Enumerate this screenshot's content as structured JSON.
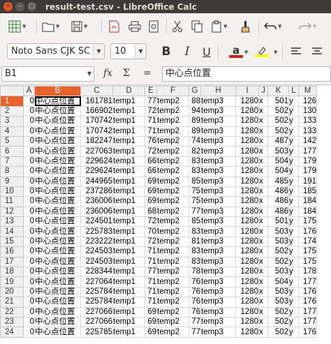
{
  "window": {
    "title": "result-test.csv - LibreOffice Calc",
    "close_glyph": "×",
    "min_glyph": "–",
    "max_glyph": "□"
  },
  "toolbar": {
    "icons": [
      "spreadsheet-icon",
      "open-icon",
      "save-icon",
      "export-pdf-icon",
      "print-icon",
      "print-preview-icon",
      "cut-icon",
      "copy-icon",
      "paste-icon",
      "clone-formatting-icon",
      "undo-icon",
      "redo-icon"
    ]
  },
  "format": {
    "font_name": "Noto Sans CJK SC R",
    "font_size": "10",
    "bold": "B",
    "italic": "I",
    "underline": "U",
    "font_color_glyph": "a",
    "font_color": "#c9211e",
    "highlight_color": "#ffff00"
  },
  "formula_bar": {
    "cell_ref": "B1",
    "fx": "fx",
    "sigma": "Σ",
    "equals": "=",
    "content": "中心点位置"
  },
  "sheet": {
    "columns": [
      "A",
      "B",
      "C",
      "D",
      "E",
      "F",
      "G",
      "H",
      "I",
      "J",
      "K",
      "L",
      "M"
    ],
    "selected_column": "B",
    "selected_row": "1",
    "rows": [
      {
        "n": "1",
        "a": "0",
        "b": "中心点位置",
        "c": "161781",
        "d": "temp1",
        "e": "77",
        "f": "temp2",
        "g": "88",
        "h": "temp3",
        "i": "1280",
        "j": "x",
        "k": "501",
        "l": "y",
        "m": "126"
      },
      {
        "n": "2",
        "a": "0",
        "b": "中心点位置",
        "c": "166902",
        "d": "temp1",
        "e": "72",
        "f": "temp2",
        "g": "94",
        "h": "temp3",
        "i": "1280",
        "j": "x",
        "k": "502",
        "l": "y",
        "m": "130"
      },
      {
        "n": "3",
        "a": "0",
        "b": "中心点位置",
        "c": "170742",
        "d": "temp1",
        "e": "71",
        "f": "temp2",
        "g": "89",
        "h": "temp3",
        "i": "1280",
        "j": "x",
        "k": "502",
        "l": "y",
        "m": "133"
      },
      {
        "n": "4",
        "a": "0",
        "b": "中心点位置",
        "c": "170742",
        "d": "temp1",
        "e": "71",
        "f": "temp2",
        "g": "89",
        "h": "temp3",
        "i": "1280",
        "j": "x",
        "k": "502",
        "l": "y",
        "m": "133"
      },
      {
        "n": "5",
        "a": "0",
        "b": "中心点位置",
        "c": "182247",
        "d": "temp1",
        "e": "76",
        "f": "temp2",
        "g": "74",
        "h": "temp3",
        "i": "1280",
        "j": "x",
        "k": "487",
        "l": "y",
        "m": "142"
      },
      {
        "n": "6",
        "a": "0",
        "b": "中心点位置",
        "c": "227063",
        "d": "temp1",
        "e": "72",
        "f": "temp2",
        "g": "82",
        "h": "temp3",
        "i": "1280",
        "j": "x",
        "k": "503",
        "l": "y",
        "m": "177"
      },
      {
        "n": "7",
        "a": "0",
        "b": "中心点位置",
        "c": "229624",
        "d": "temp1",
        "e": "66",
        "f": "temp2",
        "g": "83",
        "h": "temp3",
        "i": "1280",
        "j": "x",
        "k": "504",
        "l": "y",
        "m": "179"
      },
      {
        "n": "8",
        "a": "0",
        "b": "中心点位置",
        "c": "229624",
        "d": "temp1",
        "e": "66",
        "f": "temp2",
        "g": "83",
        "h": "temp3",
        "i": "1280",
        "j": "x",
        "k": "504",
        "l": "y",
        "m": "179"
      },
      {
        "n": "9",
        "a": "0",
        "b": "中心点位置",
        "c": "244965",
        "d": "temp1",
        "e": "69",
        "f": "temp2",
        "g": "85",
        "h": "temp3",
        "i": "1280",
        "j": "x",
        "k": "485",
        "l": "y",
        "m": "191"
      },
      {
        "n": "10",
        "a": "0",
        "b": "中心点位置",
        "c": "237286",
        "d": "temp1",
        "e": "69",
        "f": "temp2",
        "g": "75",
        "h": "temp3",
        "i": "1280",
        "j": "x",
        "k": "486",
        "l": "y",
        "m": "185"
      },
      {
        "n": "11",
        "a": "0",
        "b": "中心点位置",
        "c": "236006",
        "d": "temp1",
        "e": "69",
        "f": "temp2",
        "g": "75",
        "h": "temp3",
        "i": "1280",
        "j": "x",
        "k": "486",
        "l": "y",
        "m": "184"
      },
      {
        "n": "12",
        "a": "0",
        "b": "中心点位置",
        "c": "236006",
        "d": "temp1",
        "e": "68",
        "f": "temp2",
        "g": "77",
        "h": "temp3",
        "i": "1280",
        "j": "x",
        "k": "486",
        "l": "y",
        "m": "184"
      },
      {
        "n": "13",
        "a": "0",
        "b": "中心点位置",
        "c": "224501",
        "d": "temp1",
        "e": "72",
        "f": "temp2",
        "g": "85",
        "h": "temp3",
        "i": "1280",
        "j": "x",
        "k": "501",
        "l": "y",
        "m": "175"
      },
      {
        "n": "14",
        "a": "0",
        "b": "中心点位置",
        "c": "225783",
        "d": "temp1",
        "e": "70",
        "f": "temp2",
        "g": "83",
        "h": "temp3",
        "i": "1280",
        "j": "x",
        "k": "503",
        "l": "y",
        "m": "176"
      },
      {
        "n": "15",
        "a": "0",
        "b": "中心点位置",
        "c": "223222",
        "d": "temp1",
        "e": "72",
        "f": "temp2",
        "g": "81",
        "h": "temp3",
        "i": "1280",
        "j": "x",
        "k": "503",
        "l": "y",
        "m": "174"
      },
      {
        "n": "16",
        "a": "0",
        "b": "中心点位置",
        "c": "224503",
        "d": "temp1",
        "e": "71",
        "f": "temp2",
        "g": "83",
        "h": "temp3",
        "i": "1280",
        "j": "x",
        "k": "502",
        "l": "y",
        "m": "175"
      },
      {
        "n": "17",
        "a": "0",
        "b": "中心点位置",
        "c": "224503",
        "d": "temp1",
        "e": "71",
        "f": "temp2",
        "g": "83",
        "h": "temp3",
        "i": "1280",
        "j": "x",
        "k": "502",
        "l": "y",
        "m": "175"
      },
      {
        "n": "18",
        "a": "0",
        "b": "中心点位置",
        "c": "228344",
        "d": "temp1",
        "e": "77",
        "f": "temp2",
        "g": "78",
        "h": "temp3",
        "i": "1280",
        "j": "x",
        "k": "503",
        "l": "y",
        "m": "178"
      },
      {
        "n": "19",
        "a": "0",
        "b": "中心点位置",
        "c": "227064",
        "d": "temp1",
        "e": "71",
        "f": "temp2",
        "g": "76",
        "h": "temp3",
        "i": "1280",
        "j": "x",
        "k": "504",
        "l": "y",
        "m": "177"
      },
      {
        "n": "20",
        "a": "0",
        "b": "中心点位置",
        "c": "225784",
        "d": "temp1",
        "e": "71",
        "f": "temp2",
        "g": "76",
        "h": "temp3",
        "i": "1280",
        "j": "x",
        "k": "503",
        "l": "y",
        "m": "176"
      },
      {
        "n": "21",
        "a": "0",
        "b": "中心点位置",
        "c": "225784",
        "d": "temp1",
        "e": "71",
        "f": "temp2",
        "g": "76",
        "h": "temp3",
        "i": "1280",
        "j": "x",
        "k": "503",
        "l": "y",
        "m": "176"
      },
      {
        "n": "22",
        "a": "0",
        "b": "中心点位置",
        "c": "227066",
        "d": "temp1",
        "e": "69",
        "f": "temp2",
        "g": "76",
        "h": "temp3",
        "i": "1280",
        "j": "x",
        "k": "502",
        "l": "y",
        "m": "177"
      },
      {
        "n": "23",
        "a": "0",
        "b": "中心点位置",
        "c": "227066",
        "d": "temp1",
        "e": "69",
        "f": "temp2",
        "g": "77",
        "h": "temp3",
        "i": "1280",
        "j": "x",
        "k": "502",
        "l": "y",
        "m": "177"
      },
      {
        "n": "24",
        "a": "0",
        "b": "中心点位置",
        "c": "225785",
        "d": "temp1",
        "e": "69",
        "f": "temp2",
        "g": "77",
        "h": "temp3",
        "i": "1280",
        "j": "x",
        "k": "502",
        "l": "y",
        "m": "176"
      }
    ]
  }
}
